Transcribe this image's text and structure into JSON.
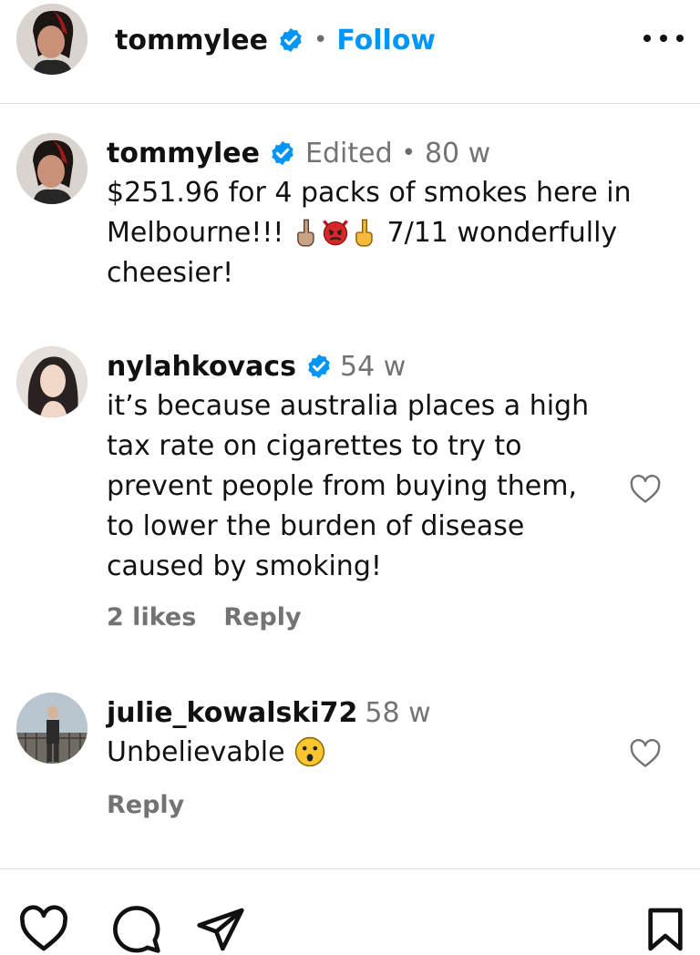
{
  "header": {
    "username": "tommylee",
    "separator": "•",
    "follow_label": "Follow",
    "more_icon": "more-horizontal-icon"
  },
  "caption": {
    "username": "tommylee",
    "edited_label": "Edited",
    "separator": "•",
    "time": "80 w",
    "text_part1": "$251.96 for 4 packs of smokes here in Melbourne!!! ",
    "text_part2": " 7/11 wonderfully cheesier!"
  },
  "comments": [
    {
      "username": "nylahkovacs",
      "verified": true,
      "time": "54 w",
      "text": "it’s because australia places a high tax rate on cigarettes to try to prevent people from buying them, to lower the burden of disease caused by smoking!",
      "likes": "2 likes",
      "reply_label": "Reply"
    },
    {
      "username": "julie_kowalski72",
      "verified": false,
      "time": "58 w",
      "text": "Unbelievable ",
      "reply_label": "Reply"
    }
  ],
  "actions": {
    "icons": [
      "heart-icon",
      "comment-icon",
      "share-icon",
      "bookmark-icon"
    ]
  },
  "colors": {
    "accent": "#0095f6",
    "muted": "#737373",
    "divider": "#dbdbdb"
  }
}
